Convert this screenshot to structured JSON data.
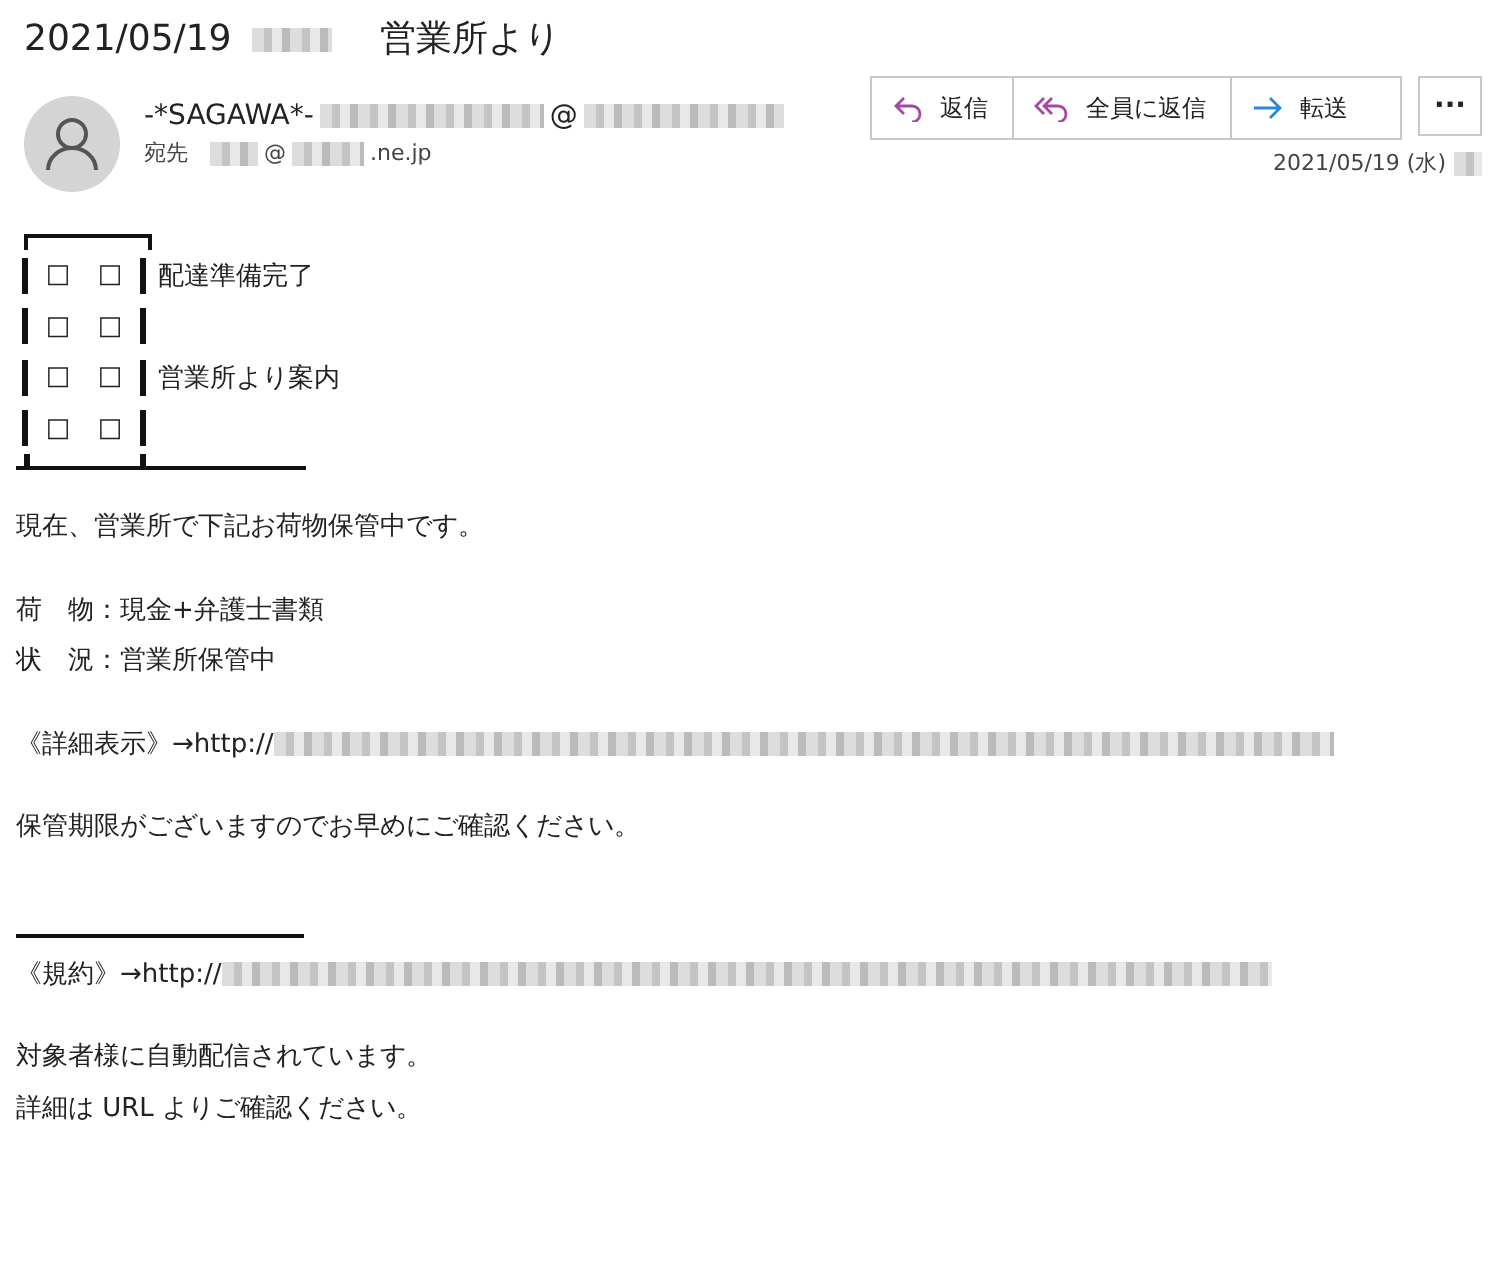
{
  "message": {
    "subject_date": "2021/05/19",
    "subject": "営業所より",
    "sender": "-*SAGAWA*-",
    "sender_at": "@",
    "to_label": "宛先",
    "to_at": "@",
    "to_domain": ".ne.jp",
    "date": "2021/05/19 (水)",
    "actions": [
      {
        "kind": "reply",
        "label": "返信"
      },
      {
        "kind": "reply-all",
        "label": "全員に返信"
      },
      {
        "kind": "forward",
        "label": "転送"
      }
    ],
    "more": "···"
  },
  "body": {
    "building": [
      {
        "windows": [
          "□",
          "□"
        ],
        "label": "配達準備完了"
      },
      {
        "windows": [
          "□",
          "□"
        ]
      },
      {
        "windows": [
          "□",
          "□"
        ],
        "label": "営業所より案内"
      },
      {
        "windows": [
          "□",
          "□"
        ]
      }
    ],
    "blocks": [
      {
        "kind": "text",
        "lines": [
          "現在、営業所で下記お荷物保管中です。"
        ]
      },
      {
        "kind": "text",
        "lines": [
          "荷　物：現金+弁護士書類",
          "状　況：営業所保管中"
        ]
      },
      {
        "kind": "link",
        "text": "《詳細表示》→http://"
      },
      {
        "kind": "text",
        "lines": [
          "保管期限がございますのでお早めにご確認ください。"
        ]
      },
      {
        "kind": "rule"
      },
      {
        "kind": "link",
        "text": "《規約》→http://"
      },
      {
        "kind": "text",
        "lines": [
          "対象者様に自動配信されています。",
          "詳細は URL よりご確認ください。"
        ]
      }
    ]
  }
}
